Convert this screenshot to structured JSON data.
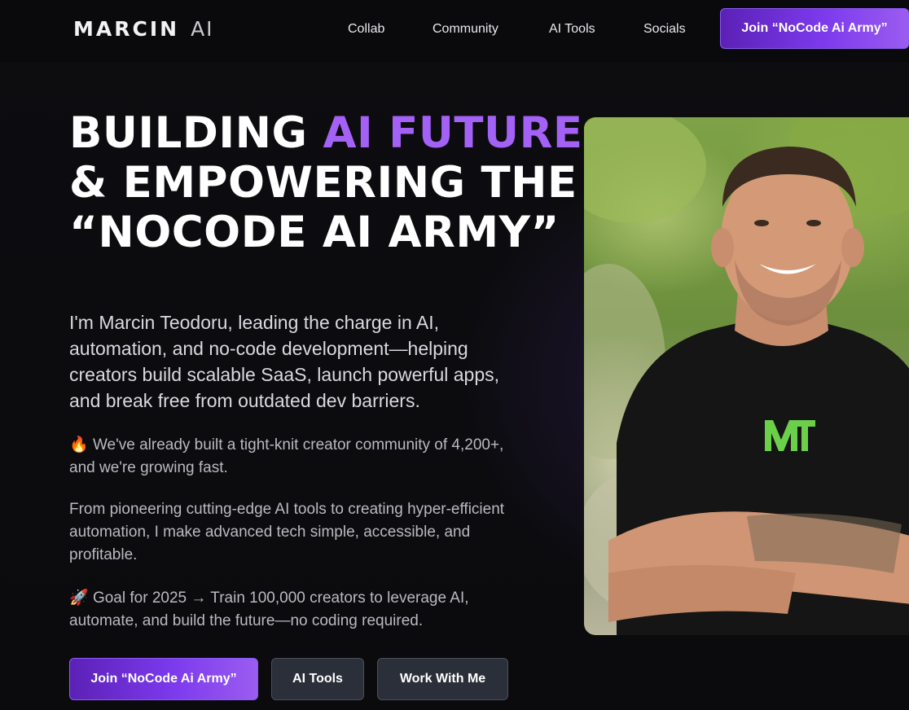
{
  "header": {
    "logo": {
      "word": "MARCIN",
      "suffix": "AI"
    },
    "nav": [
      {
        "label": "Collab"
      },
      {
        "label": "Community"
      },
      {
        "label": "AI Tools"
      },
      {
        "label": "Socials"
      }
    ],
    "cta_label": "Join “NoCode Ai Army”"
  },
  "hero": {
    "headline": {
      "line1_white": "BUILDING ",
      "line1_accent": "AI FUTURE",
      "line2": "& EMPOWERING THE",
      "line3": "“NOCODE AI ARMY”"
    },
    "intro": "I'm Marcin Teodoru, leading the charge in AI, automation, and no-code development—helping creators build scalable SaaS, launch powerful apps, and break free from outdated dev barriers.",
    "community_emoji": "🔥",
    "community_text": "We've already built a tight-knit creator community of 4,200+, and we're growing fast.",
    "tools_text": "From pioneering cutting-edge AI tools to creating hyper-efficient automation, I make advanced tech simple, accessible, and profitable.",
    "goal_emoji": "🚀",
    "goal_text": "Goal for 2025 → Train 100,000 creators to leverage AI, automate, and build the future—no coding required.",
    "buttons": {
      "join": "Join “NoCode Ai Army”",
      "ai_tools": "AI Tools",
      "work": "Work With Me"
    },
    "photo_alt": "Portrait photo"
  },
  "colors": {
    "accent": "#a461f5",
    "button_purple": "#7c3aed",
    "button_dark": "#2b2f3a",
    "background": "#0b0b0d"
  }
}
